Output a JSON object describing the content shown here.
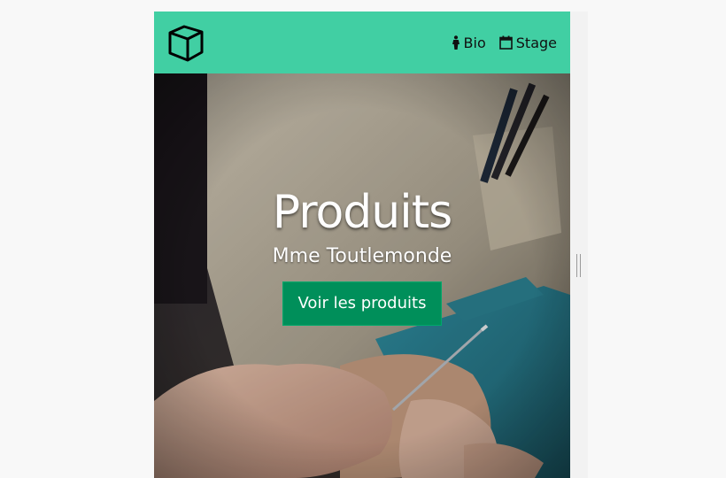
{
  "nav": {
    "logo_icon": "cube-icon",
    "items": [
      {
        "icon": "female-figure-icon",
        "label": "Bio"
      },
      {
        "icon": "calendar-icon",
        "label": "Stage"
      }
    ],
    "background_color": "#41cfa3"
  },
  "hero": {
    "title": "Produits",
    "subtitle": "Mme Toutlemonde",
    "button_label": "Voir les produits",
    "button_color": "#008f5a",
    "image_description_icon": "craftsman-carving-shoe-last-photo"
  }
}
